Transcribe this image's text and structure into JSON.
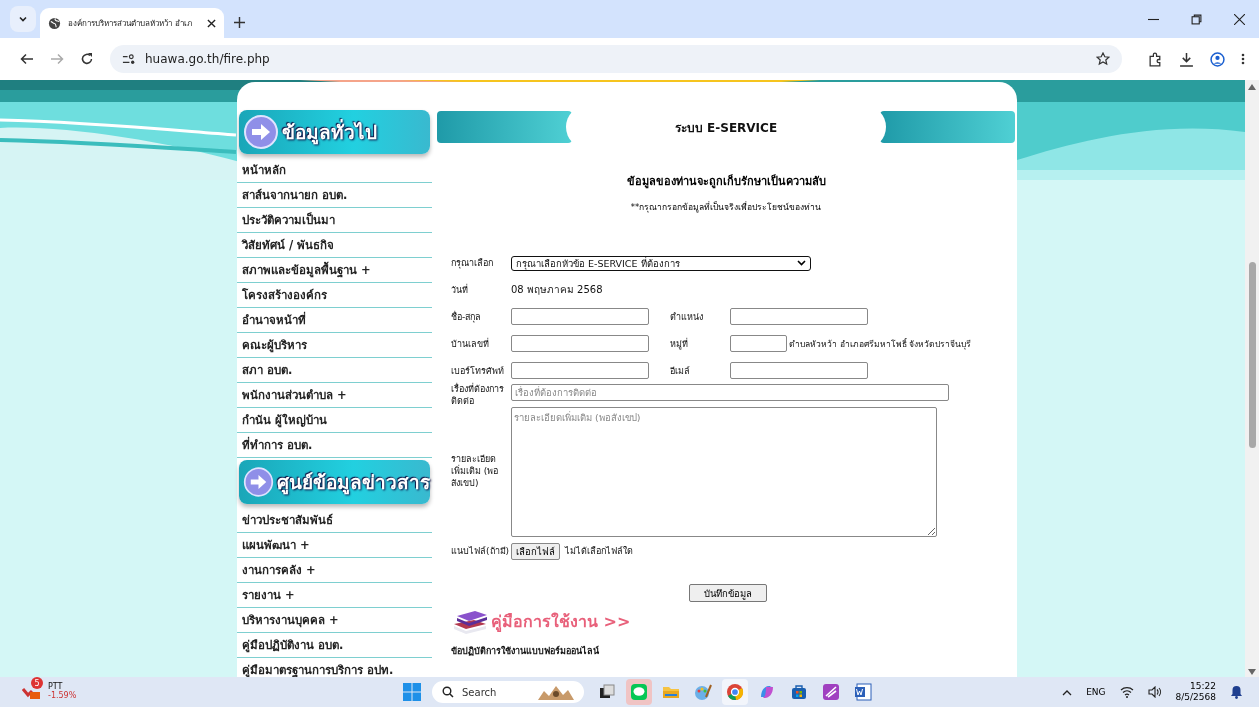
{
  "browser": {
    "tab_title": "องค์การบริหารส่วนตำบลหัวหว้า อำเภ",
    "url": "huawa.go.th/fire.php"
  },
  "sidebar": [
    {
      "title": "ข้อมูลทั่วไป",
      "items": [
        "หน้าหลัก",
        "สาส์นจากนายก อบต.",
        "ประวัติความเป็นมา",
        "วิสัยทัศน์ / พันธกิจ",
        "สภาพและข้อมูลพื้นฐาน +",
        "โครงสร้างองค์กร",
        "อำนาจหน้าที่",
        "คณะผู้บริหาร",
        "สภา อบต.",
        "พนักงานส่วนตำบล +",
        "กำนัน ผู้ใหญ่บ้าน",
        "ที่ทำการ อบต."
      ]
    },
    {
      "title": "ศูนย์ข้อมูลข่าวสาร",
      "items": [
        "ข่าวประชาสัมพันธ์",
        "แผนพัฒนา +",
        "งานการคลัง +",
        "รายงาน +",
        "บริหารงานบุคคล +",
        "คู่มือปฏิบัติงาน อบต.",
        "คู่มือมาตรฐานการบริการ อปท."
      ]
    }
  ],
  "form": {
    "header": "ระบบ E-SERVICE",
    "notice": "ข้อมูลของท่านจะถูกเก็บรักษาเป็นความลับ",
    "hint": "**กรุณากรอกข้อมูลที่เป็นจริงเพื่อประโยชน์ของท่าน",
    "select_label": "กรุณาเลือก",
    "select_value": "กรุณาเลือกหัวข้อ E-SERVICE ที่ต้องการ",
    "date_label": "วันที่",
    "date_value": "08 พฤษภาคม 2568",
    "name_label": "ชื่อ-สกุล",
    "position_label": "ตำแหน่ง",
    "house_label": "บ้านเลขที่",
    "village_label": "หมู่ที่",
    "address_text": "ตำบลหัวหว้า อำเภอศรีมหาโพธิ์ จังหวัดปราจีนบุรี",
    "phone_label": "เบอร์โทรศัพท์",
    "email_label": "อีเมล์",
    "subject_label": "เรื่องที่ต้องการติดต่อ",
    "subject_placeholder": "เรื่องที่ต้องการติดต่อ",
    "details_label": "รายละเอียดเพิ่มเติม (พอสังเขป)",
    "details_placeholder": "รายละเอียดเพิ่มเติม (พอสังเขป)",
    "file_label": "แนบไฟล์(ถ้ามี)",
    "file_button": "เลือกไฟล์",
    "file_status": "ไม่ได้เลือกไฟล์ใด",
    "submit": "บันทึกข้อมูล",
    "manual_link": "คู่มือการใช้งาน >>",
    "rules_title": "ข้อปฏิบัติการใช้งานแบบฟอร์มออนไลน์"
  },
  "taskbar": {
    "stock": {
      "symbol": "PTT",
      "change": "-1.59%",
      "badge": "5"
    },
    "search_placeholder": "Search",
    "apps": [
      {
        "kind": "taskview",
        "active": false
      },
      {
        "kind": "line",
        "active": true
      },
      {
        "kind": "folder",
        "active": false
      },
      {
        "kind": "paint",
        "active": false
      },
      {
        "kind": "chrome",
        "active": true
      },
      {
        "kind": "copilot",
        "active": false
      },
      {
        "kind": "store",
        "active": false
      },
      {
        "kind": "clip",
        "active": false
      },
      {
        "kind": "word",
        "active": false
      }
    ],
    "language": "ENG",
    "time": "15:22",
    "date": "8/5/2568"
  }
}
